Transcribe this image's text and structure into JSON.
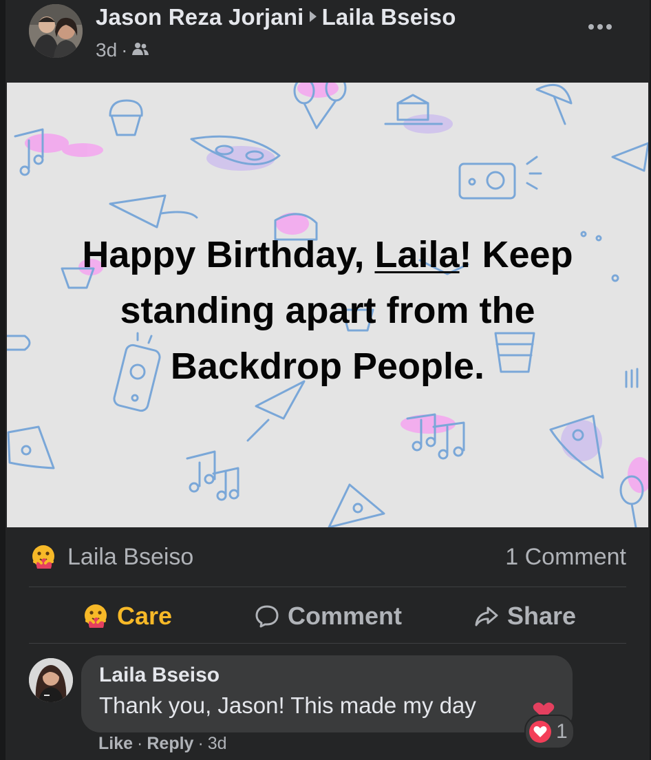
{
  "post": {
    "author": "Jason Reza Jorjani",
    "recipient": "Laila Bseiso",
    "time": "3d",
    "separator": "·",
    "audience_icon": "friends-icon",
    "more_icon": "more-horizontal-icon"
  },
  "birthday_card": {
    "text_before": "Happy Birthday, ",
    "tagged_name": "Laila",
    "text_after": "! Keep standing apart from the Backdrop People."
  },
  "reactions": {
    "emoji": "care-reaction-icon",
    "names": "Laila Bseiso",
    "comment_count": "1 Comment"
  },
  "actions": {
    "care_label": "Care",
    "comment_label": "Comment",
    "share_label": "Share"
  },
  "comment": {
    "author": "Laila Bseiso",
    "text": "Thank you, Jason! This made my day",
    "reaction_count": "1",
    "like_label": "Like",
    "reply_label": "Reply",
    "dot": "·",
    "time": "3d"
  },
  "colors": {
    "background": "#18191a",
    "card": "#242526",
    "bubble": "#3a3b3c",
    "primary_text": "#e4e6eb",
    "secondary_text": "#b0b3b8",
    "care_color": "#f7b928",
    "birthday_bg": "#e4e4e4",
    "accent_pink": "#f28ee8",
    "accent_blue": "#7aa7d8"
  }
}
